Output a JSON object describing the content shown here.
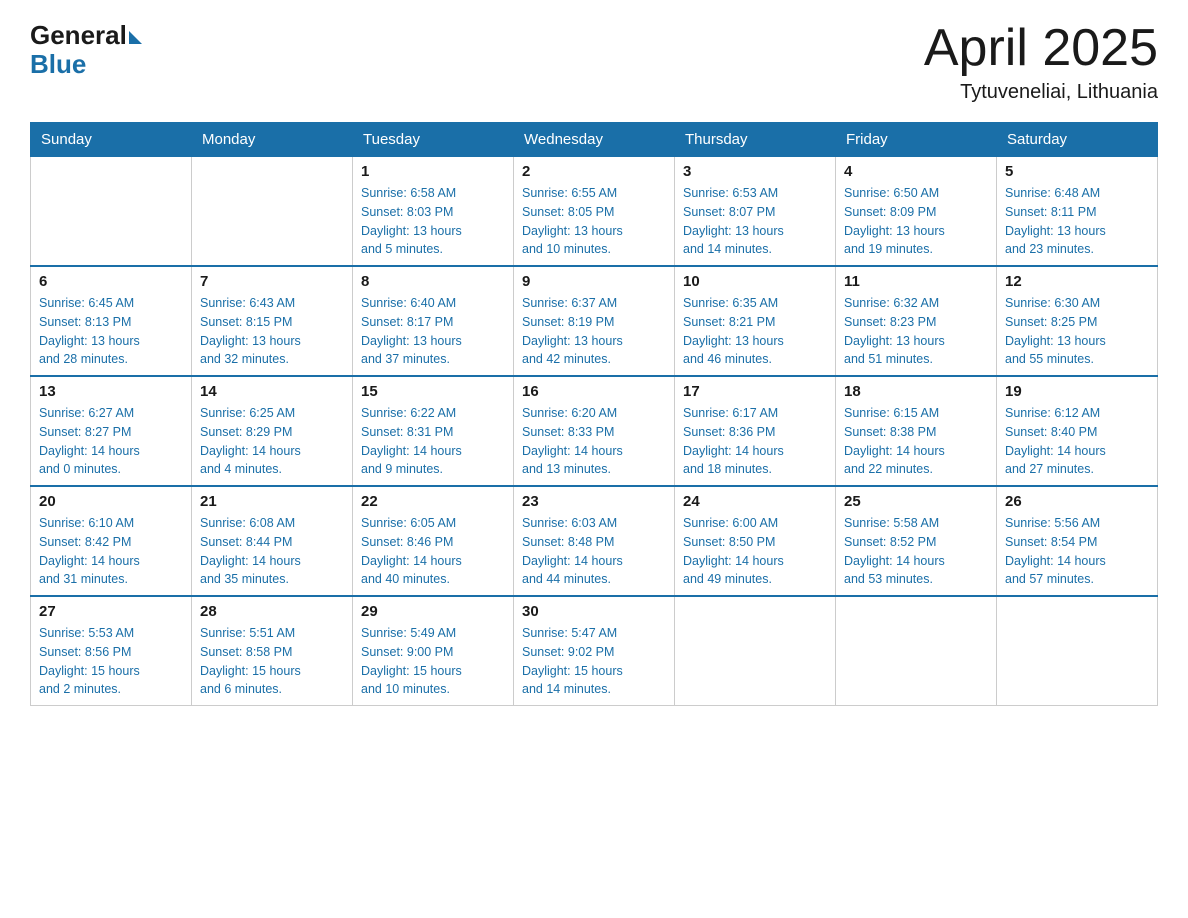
{
  "header": {
    "logo_general": "General",
    "logo_blue": "Blue",
    "title": "April 2025",
    "subtitle": "Tytuveneliai, Lithuania"
  },
  "days_of_week": [
    "Sunday",
    "Monday",
    "Tuesday",
    "Wednesday",
    "Thursday",
    "Friday",
    "Saturday"
  ],
  "weeks": [
    [
      {
        "day": "",
        "info": ""
      },
      {
        "day": "",
        "info": ""
      },
      {
        "day": "1",
        "info": "Sunrise: 6:58 AM\nSunset: 8:03 PM\nDaylight: 13 hours\nand 5 minutes."
      },
      {
        "day": "2",
        "info": "Sunrise: 6:55 AM\nSunset: 8:05 PM\nDaylight: 13 hours\nand 10 minutes."
      },
      {
        "day": "3",
        "info": "Sunrise: 6:53 AM\nSunset: 8:07 PM\nDaylight: 13 hours\nand 14 minutes."
      },
      {
        "day": "4",
        "info": "Sunrise: 6:50 AM\nSunset: 8:09 PM\nDaylight: 13 hours\nand 19 minutes."
      },
      {
        "day": "5",
        "info": "Sunrise: 6:48 AM\nSunset: 8:11 PM\nDaylight: 13 hours\nand 23 minutes."
      }
    ],
    [
      {
        "day": "6",
        "info": "Sunrise: 6:45 AM\nSunset: 8:13 PM\nDaylight: 13 hours\nand 28 minutes."
      },
      {
        "day": "7",
        "info": "Sunrise: 6:43 AM\nSunset: 8:15 PM\nDaylight: 13 hours\nand 32 minutes."
      },
      {
        "day": "8",
        "info": "Sunrise: 6:40 AM\nSunset: 8:17 PM\nDaylight: 13 hours\nand 37 minutes."
      },
      {
        "day": "9",
        "info": "Sunrise: 6:37 AM\nSunset: 8:19 PM\nDaylight: 13 hours\nand 42 minutes."
      },
      {
        "day": "10",
        "info": "Sunrise: 6:35 AM\nSunset: 8:21 PM\nDaylight: 13 hours\nand 46 minutes."
      },
      {
        "day": "11",
        "info": "Sunrise: 6:32 AM\nSunset: 8:23 PM\nDaylight: 13 hours\nand 51 minutes."
      },
      {
        "day": "12",
        "info": "Sunrise: 6:30 AM\nSunset: 8:25 PM\nDaylight: 13 hours\nand 55 minutes."
      }
    ],
    [
      {
        "day": "13",
        "info": "Sunrise: 6:27 AM\nSunset: 8:27 PM\nDaylight: 14 hours\nand 0 minutes."
      },
      {
        "day": "14",
        "info": "Sunrise: 6:25 AM\nSunset: 8:29 PM\nDaylight: 14 hours\nand 4 minutes."
      },
      {
        "day": "15",
        "info": "Sunrise: 6:22 AM\nSunset: 8:31 PM\nDaylight: 14 hours\nand 9 minutes."
      },
      {
        "day": "16",
        "info": "Sunrise: 6:20 AM\nSunset: 8:33 PM\nDaylight: 14 hours\nand 13 minutes."
      },
      {
        "day": "17",
        "info": "Sunrise: 6:17 AM\nSunset: 8:36 PM\nDaylight: 14 hours\nand 18 minutes."
      },
      {
        "day": "18",
        "info": "Sunrise: 6:15 AM\nSunset: 8:38 PM\nDaylight: 14 hours\nand 22 minutes."
      },
      {
        "day": "19",
        "info": "Sunrise: 6:12 AM\nSunset: 8:40 PM\nDaylight: 14 hours\nand 27 minutes."
      }
    ],
    [
      {
        "day": "20",
        "info": "Sunrise: 6:10 AM\nSunset: 8:42 PM\nDaylight: 14 hours\nand 31 minutes."
      },
      {
        "day": "21",
        "info": "Sunrise: 6:08 AM\nSunset: 8:44 PM\nDaylight: 14 hours\nand 35 minutes."
      },
      {
        "day": "22",
        "info": "Sunrise: 6:05 AM\nSunset: 8:46 PM\nDaylight: 14 hours\nand 40 minutes."
      },
      {
        "day": "23",
        "info": "Sunrise: 6:03 AM\nSunset: 8:48 PM\nDaylight: 14 hours\nand 44 minutes."
      },
      {
        "day": "24",
        "info": "Sunrise: 6:00 AM\nSunset: 8:50 PM\nDaylight: 14 hours\nand 49 minutes."
      },
      {
        "day": "25",
        "info": "Sunrise: 5:58 AM\nSunset: 8:52 PM\nDaylight: 14 hours\nand 53 minutes."
      },
      {
        "day": "26",
        "info": "Sunrise: 5:56 AM\nSunset: 8:54 PM\nDaylight: 14 hours\nand 57 minutes."
      }
    ],
    [
      {
        "day": "27",
        "info": "Sunrise: 5:53 AM\nSunset: 8:56 PM\nDaylight: 15 hours\nand 2 minutes."
      },
      {
        "day": "28",
        "info": "Sunrise: 5:51 AM\nSunset: 8:58 PM\nDaylight: 15 hours\nand 6 minutes."
      },
      {
        "day": "29",
        "info": "Sunrise: 5:49 AM\nSunset: 9:00 PM\nDaylight: 15 hours\nand 10 minutes."
      },
      {
        "day": "30",
        "info": "Sunrise: 5:47 AM\nSunset: 9:02 PM\nDaylight: 15 hours\nand 14 minutes."
      },
      {
        "day": "",
        "info": ""
      },
      {
        "day": "",
        "info": ""
      },
      {
        "day": "",
        "info": ""
      }
    ]
  ]
}
